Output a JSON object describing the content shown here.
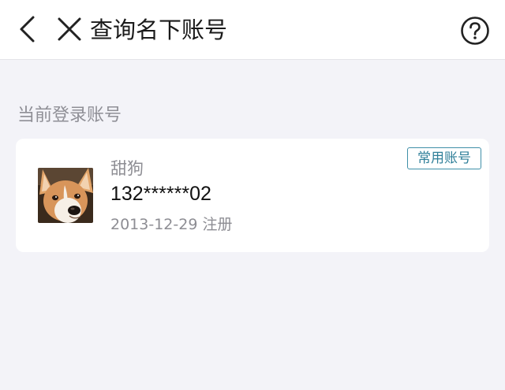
{
  "header": {
    "title": "查询名下账号",
    "back_icon": "chevron-left-icon",
    "close_icon": "close-icon",
    "help_icon": "question-circle-icon"
  },
  "section": {
    "label": "当前登录账号"
  },
  "account": {
    "nickname": "甜狗",
    "phone": "132******02",
    "registered": "2013-12-29 注册",
    "badge": "常用账号",
    "avatar": "corgi-dog-avatar"
  },
  "colors": {
    "background": "#f3f3f8",
    "card": "#ffffff",
    "badge": "#2f7f99",
    "muted_text": "#8d8d93"
  }
}
